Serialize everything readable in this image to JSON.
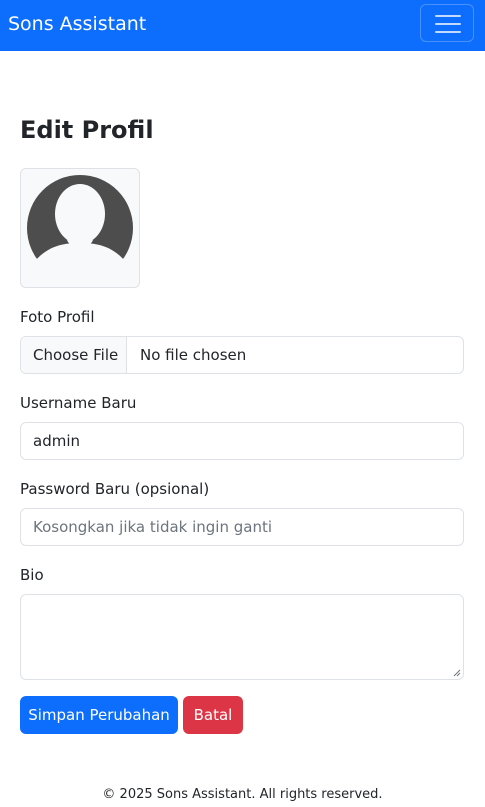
{
  "navbar": {
    "brand": "Sons Assistant",
    "toggle_icon": "hamburger-icon"
  },
  "page": {
    "title": "Edit Profil"
  },
  "avatar": {
    "icon": "user-avatar-icon"
  },
  "form": {
    "photo_label": "Foto Profil",
    "file_button_label": "Choose File",
    "file_status": "No file chosen",
    "username_label": "Username Baru",
    "username_value": "admin",
    "password_label": "Password Baru (opsional)",
    "password_placeholder": "Kosongkan jika tidak ingin ganti",
    "bio_label": "Bio",
    "bio_value": ""
  },
  "actions": {
    "save_label": "Simpan Perubahan",
    "cancel_label": "Batal"
  },
  "footer": {
    "text": "© 2025 Sons Assistant. All rights reserved."
  },
  "colors": {
    "primary": "#0d6efd",
    "danger": "#dc3545",
    "border": "#dee2e6"
  }
}
